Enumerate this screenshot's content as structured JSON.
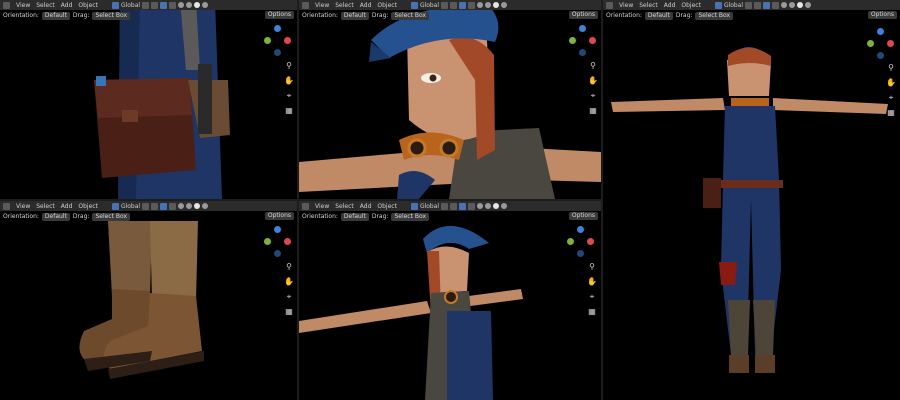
{
  "header": {
    "menu": [
      "View",
      "Select",
      "Add",
      "Object"
    ],
    "transform_space": "Global",
    "orientation_label": "Orientation:",
    "orientation_value": "Default",
    "drag_label": "Drag:",
    "drag_value": "Select Box",
    "options_label": "Options"
  },
  "colors": {
    "header_bg": "#2b2b2b",
    "viewport_bg": "#000000",
    "axis_x": "#e0484f",
    "axis_y": "#7fb23a",
    "axis_z": "#3d83d8",
    "denim": "#1f3566",
    "skin": "#c08a66",
    "leather": "#4a1f16"
  },
  "nav_icons": [
    "zoom-icon",
    "hand-pan-icon",
    "camera-icon",
    "grid-icon"
  ]
}
